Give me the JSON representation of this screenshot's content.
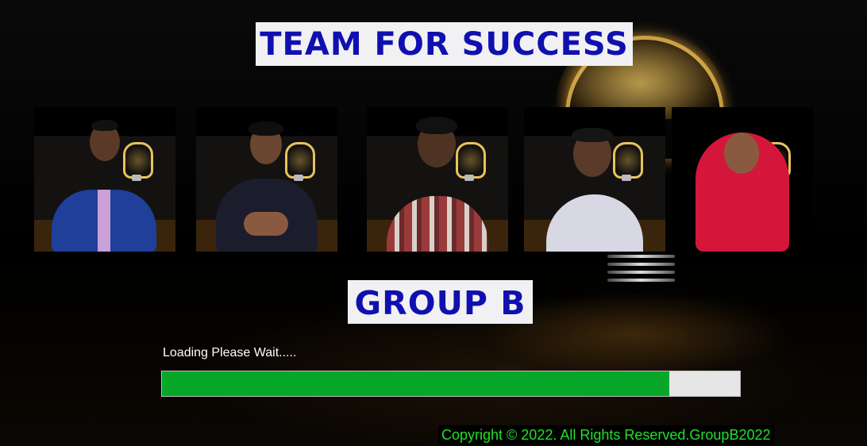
{
  "header": {
    "title": "TEAM FOR SUCCESS"
  },
  "team": {
    "name": "GROUP B",
    "members": [
      {
        "id": 1,
        "outfit": "blue-suit",
        "skin": "#5a3a26",
        "torso_color": "#1f3f9a",
        "accent": "#c9a0d8"
      },
      {
        "id": 2,
        "outfit": "dark-shirt",
        "skin": "#6a4530",
        "torso_color": "#1b1d2c",
        "accent": "#d9d9d9"
      },
      {
        "id": 3,
        "outfit": "plaid-shirt",
        "skin": "#4e3222",
        "torso_color": "#9a3a3a",
        "accent": "#d8d0c8"
      },
      {
        "id": 4,
        "outfit": "white-shirt",
        "skin": "#5a3a28",
        "torso_color": "#d8d8e4",
        "accent": "#ffffff"
      },
      {
        "id": 5,
        "outfit": "red-hijab",
        "skin": "#8a5a40",
        "torso_color": "#d4163a",
        "accent": "#c2102e"
      }
    ]
  },
  "loading": {
    "label": "Loading Please Wait.....",
    "progress_percent": 87.8
  },
  "footer": {
    "copyright": "Copyright © 2022. All Rights Reserved.GroupB2022"
  },
  "colors": {
    "title_text": "#1010b0",
    "banner_bg": "#f1f1f3",
    "progress": "#06a728",
    "copyright": "#22e02a"
  },
  "icons": {
    "background": "lightbulb-icon"
  }
}
